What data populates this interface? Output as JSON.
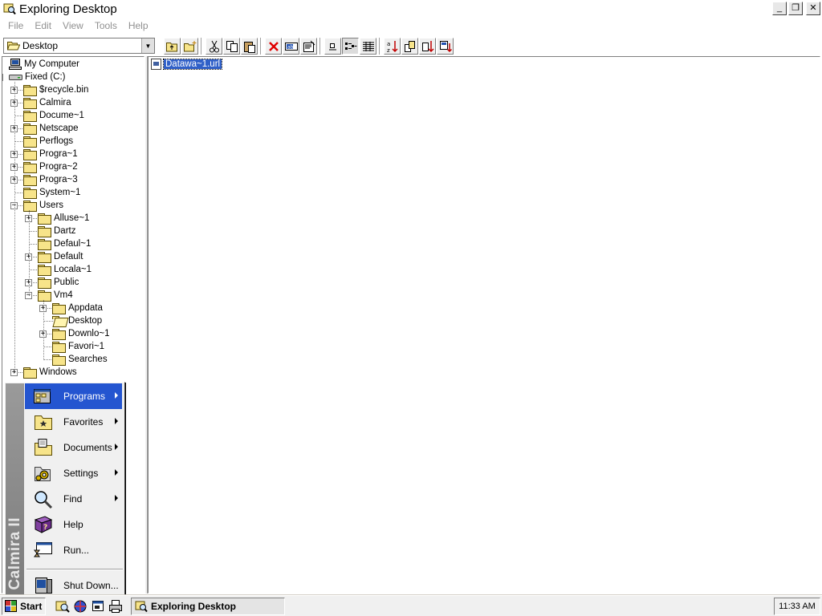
{
  "window": {
    "title": "Exploring Desktop",
    "minimize_glyph": "_",
    "restore_glyph": "❐",
    "close_glyph": "✕"
  },
  "menubar": {
    "items": [
      "File",
      "Edit",
      "View",
      "Tools",
      "Help"
    ]
  },
  "toolbar": {
    "location_value": "Desktop",
    "buttons": [
      "up-one-level-icon",
      "new-folder-icon",
      "cut-icon",
      "copy-icon",
      "paste-icon",
      "delete-icon",
      "rename-icon",
      "properties-icon",
      "large-icons-icon",
      "list-view-icon",
      "details-view-icon",
      "sort-by-name-icon",
      "sort-by-type-icon",
      "sort-by-size-icon",
      "sort-by-date-icon"
    ],
    "pressed_button": "list-view-icon"
  },
  "tree": {
    "items": [
      {
        "label": "My Computer",
        "level": 0,
        "icon": "computer-icon",
        "expander": ""
      },
      {
        "label": "Fixed (C:)",
        "level": 0,
        "icon": "drive-icon",
        "expander": "−"
      },
      {
        "label": "$recycle.bin",
        "level": 1,
        "icon": "folder-icon",
        "expander": "+"
      },
      {
        "label": "Calmira",
        "level": 1,
        "icon": "folder-icon",
        "expander": "+"
      },
      {
        "label": "Docume~1",
        "level": 1,
        "icon": "folder-icon",
        "expander": ""
      },
      {
        "label": "Netscape",
        "level": 1,
        "icon": "folder-icon",
        "expander": "+"
      },
      {
        "label": "Perflogs",
        "level": 1,
        "icon": "folder-icon",
        "expander": ""
      },
      {
        "label": "Progra~1",
        "level": 1,
        "icon": "folder-icon",
        "expander": "+"
      },
      {
        "label": "Progra~2",
        "level": 1,
        "icon": "folder-icon",
        "expander": "+"
      },
      {
        "label": "Progra~3",
        "level": 1,
        "icon": "folder-icon",
        "expander": "+"
      },
      {
        "label": "System~1",
        "level": 1,
        "icon": "folder-icon",
        "expander": ""
      },
      {
        "label": "Users",
        "level": 1,
        "icon": "folder-icon",
        "expander": "−"
      },
      {
        "label": "Alluse~1",
        "level": 2,
        "icon": "folder-icon",
        "expander": "+"
      },
      {
        "label": "Dartz",
        "level": 2,
        "icon": "folder-icon",
        "expander": ""
      },
      {
        "label": "Defaul~1",
        "level": 2,
        "icon": "folder-icon",
        "expander": ""
      },
      {
        "label": "Default",
        "level": 2,
        "icon": "folder-icon",
        "expander": "+"
      },
      {
        "label": "Locala~1",
        "level": 2,
        "icon": "folder-icon",
        "expander": ""
      },
      {
        "label": "Public",
        "level": 2,
        "icon": "folder-icon",
        "expander": "+"
      },
      {
        "label": "Vm4",
        "level": 2,
        "icon": "folder-icon",
        "expander": "−"
      },
      {
        "label": "Appdata",
        "level": 3,
        "icon": "folder-icon",
        "expander": "+"
      },
      {
        "label": "Desktop",
        "level": 3,
        "icon": "open-folder-icon",
        "expander": ""
      },
      {
        "label": "Downlo~1",
        "level": 3,
        "icon": "folder-icon",
        "expander": "+"
      },
      {
        "label": "Favori~1",
        "level": 3,
        "icon": "folder-icon",
        "expander": ""
      },
      {
        "label": "Searches",
        "level": 3,
        "icon": "folder-icon",
        "expander": ""
      },
      {
        "label": "Windows",
        "level": 1,
        "icon": "folder-icon",
        "expander": "+"
      }
    ]
  },
  "files": {
    "items": [
      {
        "name": "Datawa~1.url",
        "icon": "internet-shortcut-icon",
        "selected": true
      }
    ]
  },
  "startmenu": {
    "brand": "Calmira II",
    "items": [
      {
        "label": "Programs",
        "icon": "programs-icon",
        "submenu": true,
        "active": true
      },
      {
        "label": "Favorites",
        "icon": "favorites-icon",
        "submenu": true
      },
      {
        "label": "Documents",
        "icon": "documents-icon",
        "submenu": true
      },
      {
        "label": "Settings",
        "icon": "settings-icon",
        "submenu": true
      },
      {
        "label": "Find",
        "icon": "find-icon",
        "submenu": true
      },
      {
        "label": "Help",
        "icon": "help-icon",
        "submenu": false
      },
      {
        "label": "Run...",
        "icon": "run-icon",
        "submenu": false
      },
      {
        "label": "Shut Down...",
        "icon": "shutdown-icon",
        "submenu": false
      }
    ]
  },
  "taskbar": {
    "start_label": "Start",
    "quick_launch": [
      "explorer-icon",
      "network-icon",
      "run-icon",
      "printer-icon"
    ],
    "task_label": "Exploring Desktop",
    "clock": "11:33 AM"
  },
  "colors": {
    "selection": "#3060c8",
    "menu_highlight": "#2455d0",
    "folder": "#f7e48a",
    "face": "#f0f0f0"
  }
}
